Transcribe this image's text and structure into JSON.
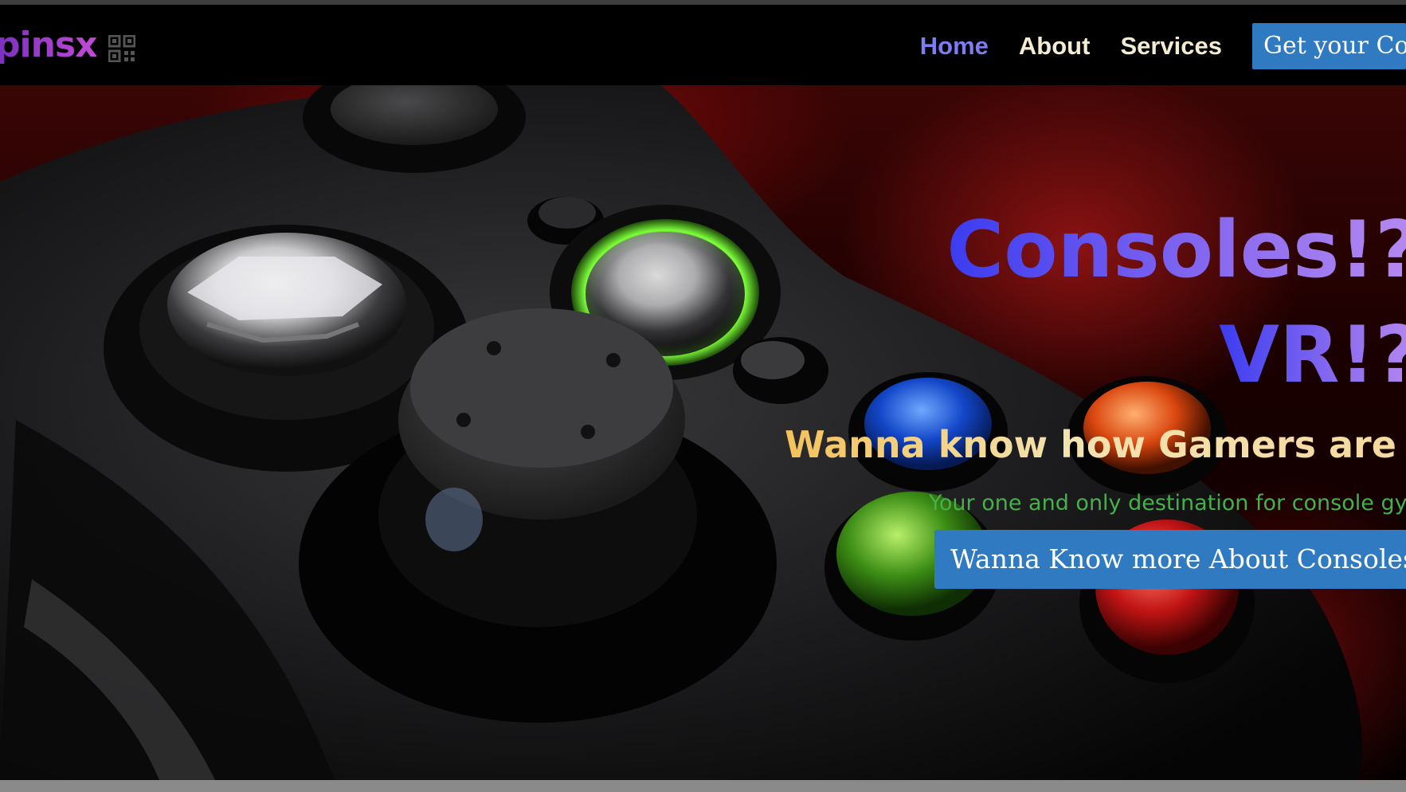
{
  "brand": {
    "name": "pinsx",
    "icon": "qr-code-icon"
  },
  "nav": {
    "items": [
      {
        "label": "Home",
        "active": true
      },
      {
        "label": "About",
        "active": false
      },
      {
        "label": "Services",
        "active": false
      }
    ],
    "cta_label": "Get your Cons"
  },
  "hero": {
    "title_line_1": "Consoles!?",
    "title_line_2": "VR!?",
    "subtitle": "Wanna know how Gamers are mad",
    "tagline": "Your one and only destination for console gy",
    "cta_label": "Wanna Know more About Consoles!",
    "background_image": "game-controller-closeup"
  },
  "colors": {
    "nav_active": "#7d7cf0",
    "nav_text": "#f4ecd0",
    "cta_background": "#2f7ac0",
    "tagline": "#46b04a"
  }
}
